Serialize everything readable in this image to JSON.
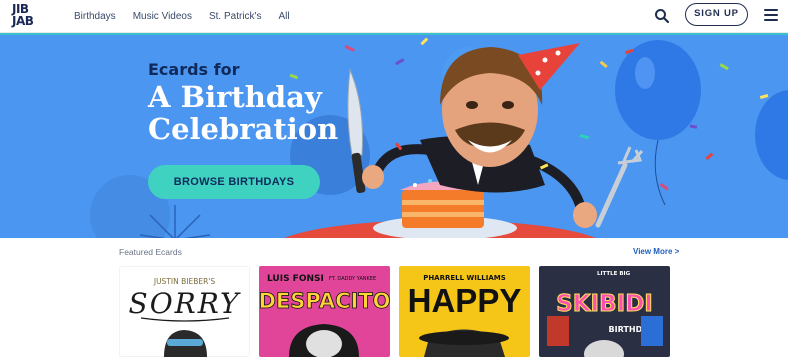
{
  "header": {
    "logo": [
      "JIB",
      "JAB"
    ],
    "nav": [
      "Birthdays",
      "Music Videos",
      "St. Patrick's",
      "All"
    ],
    "signup_label": "SIGN UP",
    "search_icon": "search-icon",
    "menu_icon": "hamburger-menu-icon"
  },
  "hero": {
    "subtitle": "Ecards for",
    "title": "A Birthday Celebration",
    "cta_label": "BROWSE BIRTHDAYS",
    "colors": {
      "background": "#4b96f0",
      "cta": "#3fd2c0",
      "subtitle": "#0f2a5a"
    }
  },
  "featured": {
    "label": "Featured Ecards",
    "view_more": "View More >",
    "cards": [
      {
        "top_text": "JUSTIN BIEBER'S",
        "title": "SORRY",
        "bg": "#ffffff"
      },
      {
        "top_text": "LUIS FONSI",
        "feat": "FT. DADDY YANKEE",
        "title": "DESPACITO",
        "bg": "#e0459a"
      },
      {
        "top_text": "PHARRELL WILLIAMS",
        "title": "HAPPY",
        "bg": "#f5c518"
      },
      {
        "top_text": "LITTLE BIG",
        "title": "SKIBIDI",
        "subtitle": "BIRTHDAY",
        "bg": "#2a2f44"
      }
    ]
  }
}
